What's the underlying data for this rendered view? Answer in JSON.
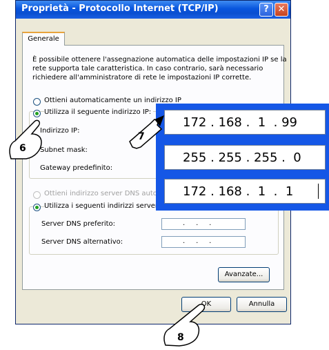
{
  "window": {
    "title": "Proprietà - Protocollo Internet (TCP/IP)",
    "help_glyph": "?",
    "close_glyph": "✕"
  },
  "tabs": [
    {
      "label": "Generale",
      "selected": true
    }
  ],
  "description": [
    "È possibile ottenere l'assegnazione automatica delle impostazioni IP se la",
    "rete supporta tale caratteristica. In caso contrario, sarà necessario",
    "richiedere all'amministratore di rete le impostazioni IP corrette."
  ],
  "ip_section": {
    "auto_option": {
      "label": "Ottieni automaticamente un indirizzo IP",
      "selected": false
    },
    "manual_option": {
      "label": "Utilizza il seguente indirizzo IP:",
      "selected": true
    },
    "fields": [
      {
        "label": "Indirizzo IP:",
        "value": "172 . 168 .  1  . 99"
      },
      {
        "label": "Subnet mask:",
        "value": "255 . 255 . 255 .  0"
      },
      {
        "label": "Gateway predefinito:",
        "value": "172 . 168 .  1  .  1"
      }
    ]
  },
  "dns_section": {
    "auto_option": {
      "label": "Ottieni indirizzo server DNS auto",
      "selected": false,
      "disabled": true
    },
    "manual_option": {
      "label": "Utilizza i seguenti indirizzi server",
      "selected": true
    },
    "fields": [
      {
        "label": "Server DNS preferito:",
        "value": ".     .     ."
      },
      {
        "label": "Server DNS alternativo:",
        "value": ".     .     ."
      }
    ]
  },
  "buttons": {
    "advanced": "Avanzate...",
    "ok": "OK",
    "cancel": "Annulla"
  },
  "callouts": {
    "step6": "6",
    "step7": "7",
    "step8": "8"
  },
  "colors": {
    "titlebar": "#0a4fd0",
    "zoom_background": "#1557e6",
    "tab_accent": "#e8a33c",
    "radio_selected": "#21a121"
  }
}
